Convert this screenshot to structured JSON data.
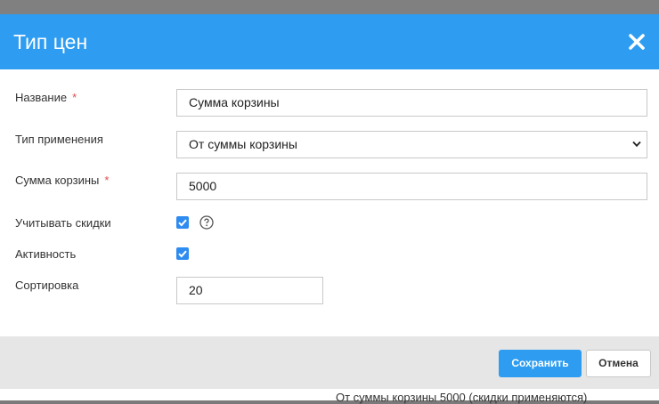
{
  "backdrop": {
    "text": "От суммы корзины 5000 (скидки применяются)"
  },
  "dialog": {
    "title": "Тип цен",
    "close_icon": "close-icon"
  },
  "form": {
    "required_mark": "*",
    "name": {
      "label": "Название",
      "value": "Сумма корзины"
    },
    "apply_type": {
      "label": "Тип применения",
      "selected": "От суммы корзины"
    },
    "cart_sum": {
      "label": "Сумма корзины",
      "value": "5000"
    },
    "consider_discounts": {
      "label": "Учитывать скидки",
      "checked": true,
      "help_icon": "question-circle-icon"
    },
    "active": {
      "label": "Активность",
      "checked": true
    },
    "sort": {
      "label": "Сортировка",
      "value": "20"
    }
  },
  "footer": {
    "save_label": "Сохранить",
    "cancel_label": "Отмена"
  },
  "colors": {
    "accent": "#2e9cf0",
    "checkbox": "#2e8bf0",
    "required": "#e04b4b",
    "footer_bg": "#e6e6e6"
  }
}
